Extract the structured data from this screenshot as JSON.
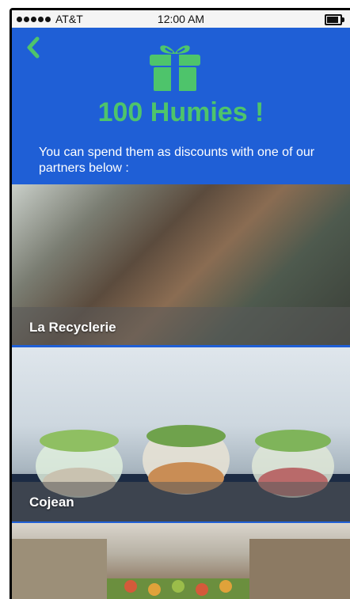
{
  "status_bar": {
    "carrier": "AT&T",
    "time": "12:00 AM"
  },
  "header": {
    "icon": "gift-icon",
    "back_icon": "chevron-left-icon",
    "title": "100 Humies !",
    "subtitle": "You can spend them as discounts with one of our partners below :"
  },
  "partners": [
    {
      "name": "La Recyclerie"
    },
    {
      "name": "Cojean"
    },
    {
      "name": ""
    }
  ],
  "colors": {
    "brand_blue": "#1f5fd6",
    "accent_green": "#4ec46b"
  }
}
